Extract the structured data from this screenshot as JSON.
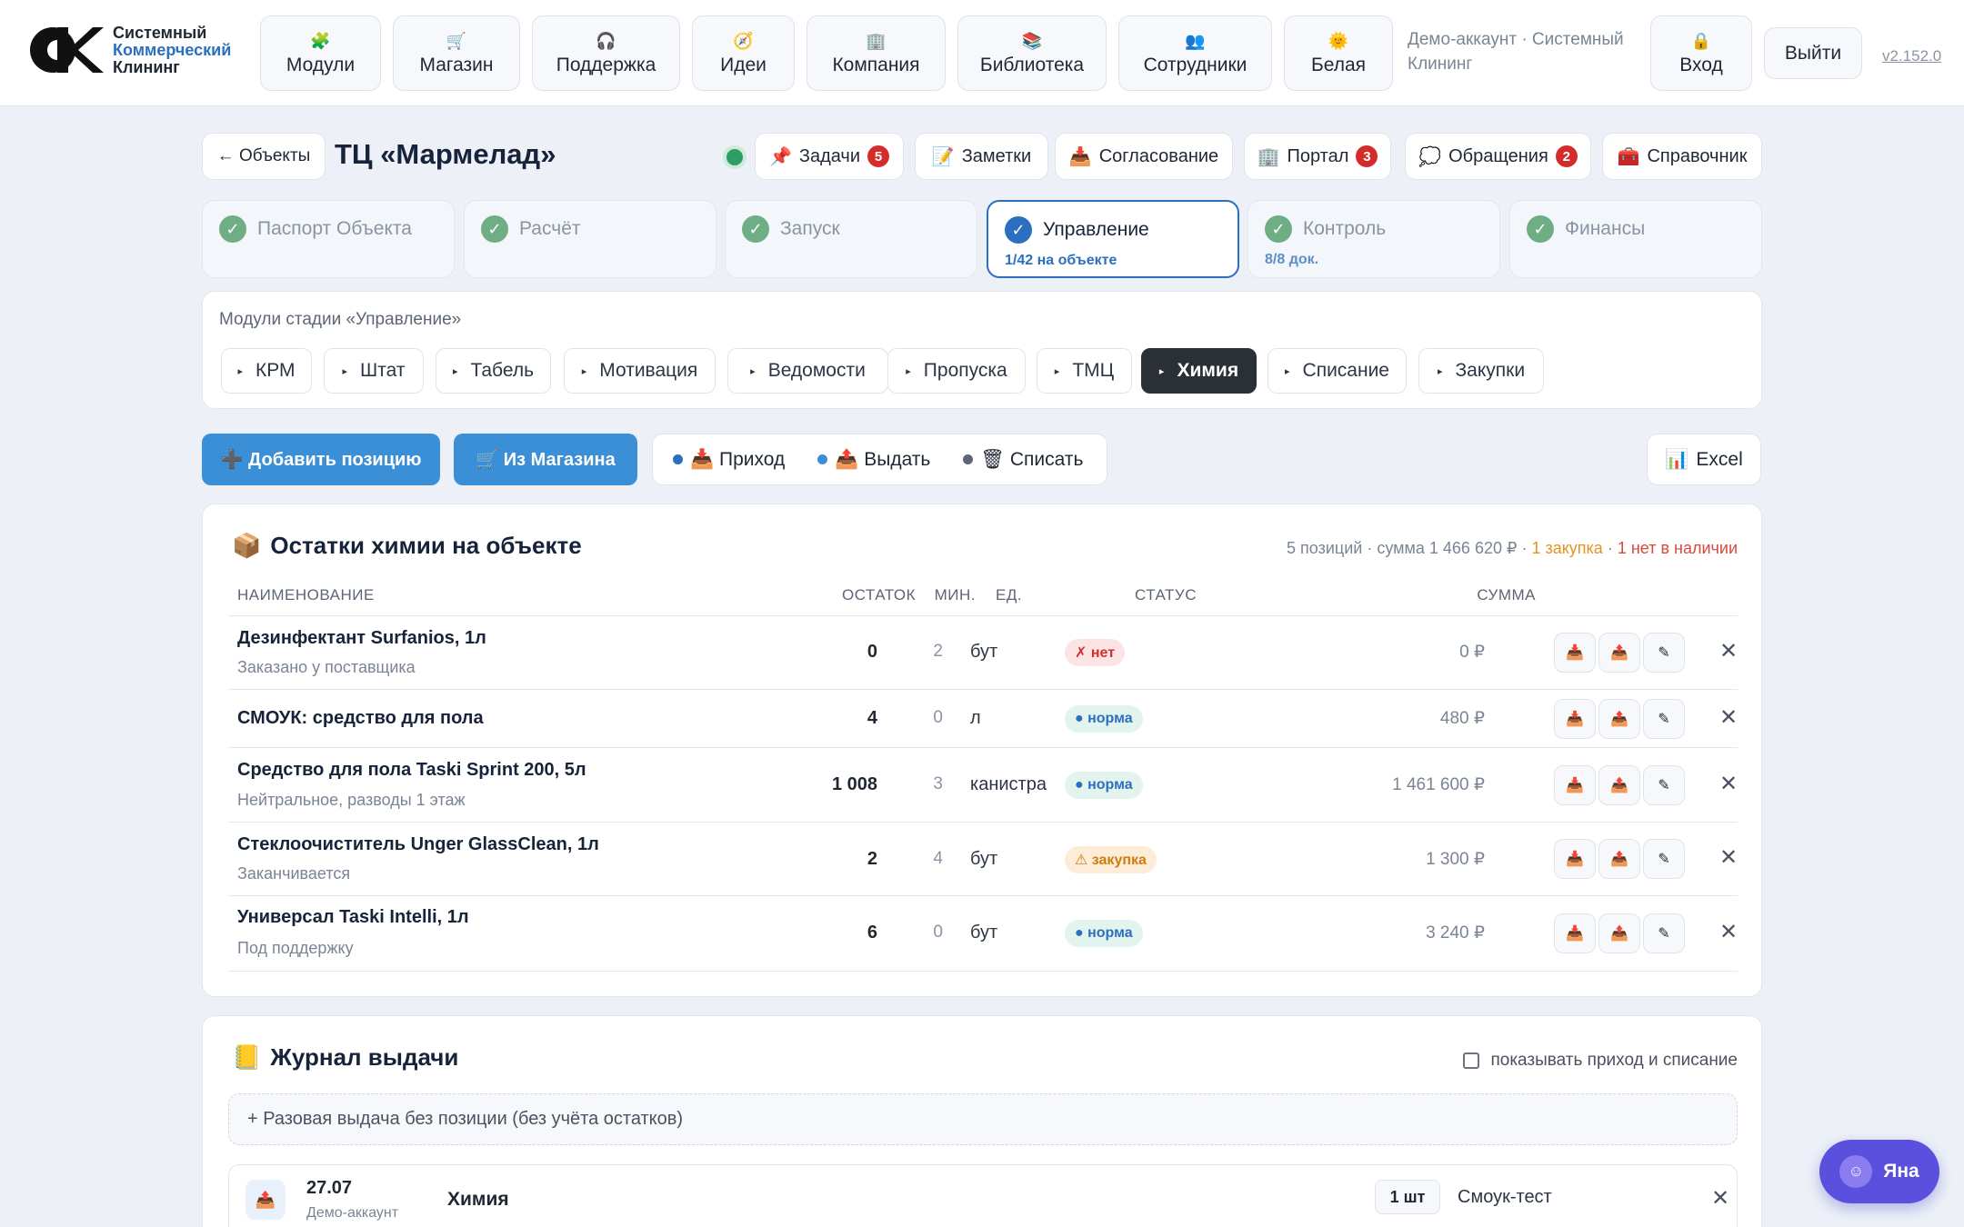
{
  "brand": {
    "line1": "Системный",
    "line2": "Коммерческий",
    "line3": "Клининг"
  },
  "nav": [
    {
      "icon": "🧩",
      "label": "Модули"
    },
    {
      "icon": "🛒",
      "label": "Магазин"
    },
    {
      "icon": "🎧",
      "label": "Поддержка"
    },
    {
      "icon": "🧭",
      "label": "Идеи"
    },
    {
      "icon": "🏢",
      "label": "Компания"
    },
    {
      "icon": "📚",
      "label": "Библиотека"
    },
    {
      "icon": "👥",
      "label": "Сотрудники"
    },
    {
      "icon": "🌞",
      "label": "Белая"
    }
  ],
  "account": {
    "text": "Демо-аккаунт · Системный Клининг"
  },
  "login": {
    "icon": "🔒",
    "label": "Вход"
  },
  "logout": "Выйти",
  "version": "v2.152.0",
  "header": {
    "back": "← Объекты",
    "title": "ТЦ «Мармелад»",
    "buttons": [
      {
        "icon": "📌",
        "label": "Задачи",
        "count": "5"
      },
      {
        "icon": "📝",
        "label": "Заметки",
        "count": ""
      },
      {
        "icon": "📥",
        "label": "Согласование",
        "count": ""
      },
      {
        "icon": "🏢",
        "label": "Портал",
        "count": "3"
      },
      {
        "icon": "💭",
        "label": "Обращения",
        "count": "2"
      },
      {
        "icon": "🧰",
        "label": "Справочник",
        "count": ""
      }
    ]
  },
  "stages": [
    {
      "label": "Паспорт Объекта",
      "sub": ""
    },
    {
      "label": "Расчёт",
      "sub": ""
    },
    {
      "label": "Запуск",
      "sub": ""
    },
    {
      "label": "Управление",
      "sub": "1/42 на объекте"
    },
    {
      "label": "Контроль",
      "sub": "8/8 док."
    },
    {
      "label": "Финансы",
      "sub": ""
    }
  ],
  "modules": {
    "label": "Модули стадии «Управление»",
    "items": [
      "КРМ",
      "Штат",
      "Табель",
      "Мотивация",
      "Ведомости",
      "Пропуска",
      "ТМЦ",
      "Химия",
      "Списание",
      "Закупки"
    ],
    "selected": "Химия"
  },
  "actions": {
    "add": "➕ Добавить позицию",
    "shop": "🛒 Из Магазина",
    "income": "📥 Приход",
    "issue": "📤 Выдать",
    "writeoff": "🗑 Списать",
    "excel": "Excel"
  },
  "stock": {
    "title": "Остатки химии на объекте",
    "summary": "5 позиций · сумма 1 466 620 ₽",
    "summary_buy": "1 закупка",
    "summary_none": "1 нет в наличии",
    "columns": {
      "name": "НАИМЕНОВАНИЕ",
      "qty": "ОСТАТОК",
      "min": "МИН.",
      "unit": "ЕД.",
      "status": "СТАТУС",
      "sum": "СУММА"
    },
    "rows": [
      {
        "name": "Дезинфектант Surfanios, 1л",
        "note": "Заказано у поставщика",
        "qty": "0",
        "min": "2",
        "unit": "бут",
        "status": "✗ нет",
        "sum": "0 ₽"
      },
      {
        "name": "СМОУК: средство для пола",
        "note": "",
        "qty": "4",
        "min": "0",
        "unit": "л",
        "status": "● норма",
        "sum": "480 ₽"
      },
      {
        "name": "Средство для пола Taski Sprint 200, 5л",
        "note": "Нейтральное, разводы 1 этаж",
        "qty": "1 008",
        "min": "3",
        "unit": "канистра",
        "status": "● норма",
        "sum": "1 461 600 ₽"
      },
      {
        "name": "Стеклоочиститель Unger GlassClean, 1л",
        "note": "Заканчивается",
        "qty": "2",
        "min": "4",
        "unit": "бут",
        "status": "⚠ закупка",
        "sum": "1 300 ₽"
      },
      {
        "name": "Универсал Taski Intelli, 1л",
        "note": "Под поддержку",
        "qty": "6",
        "min": "0",
        "unit": "бут",
        "status": "● норма",
        "sum": "3 240 ₽"
      }
    ]
  },
  "journal": {
    "title": "Журнал выдачи",
    "show_label": "показывать приход и списание",
    "oneoff": "+ Разовая выдача без позиции (без учёта остатков)",
    "entries": [
      {
        "date": "27.07",
        "user": "Демо-аккаунт",
        "category": "Химия",
        "qty": "1 шт",
        "who": "Смоук-тест"
      }
    ]
  },
  "assistant": {
    "label": "Яна"
  },
  "colors": {
    "accent": "#3b8fd6",
    "active_stage": "#2a6fc0",
    "selected_module": "#2b2f36",
    "assistant": "#5b4fdd"
  }
}
